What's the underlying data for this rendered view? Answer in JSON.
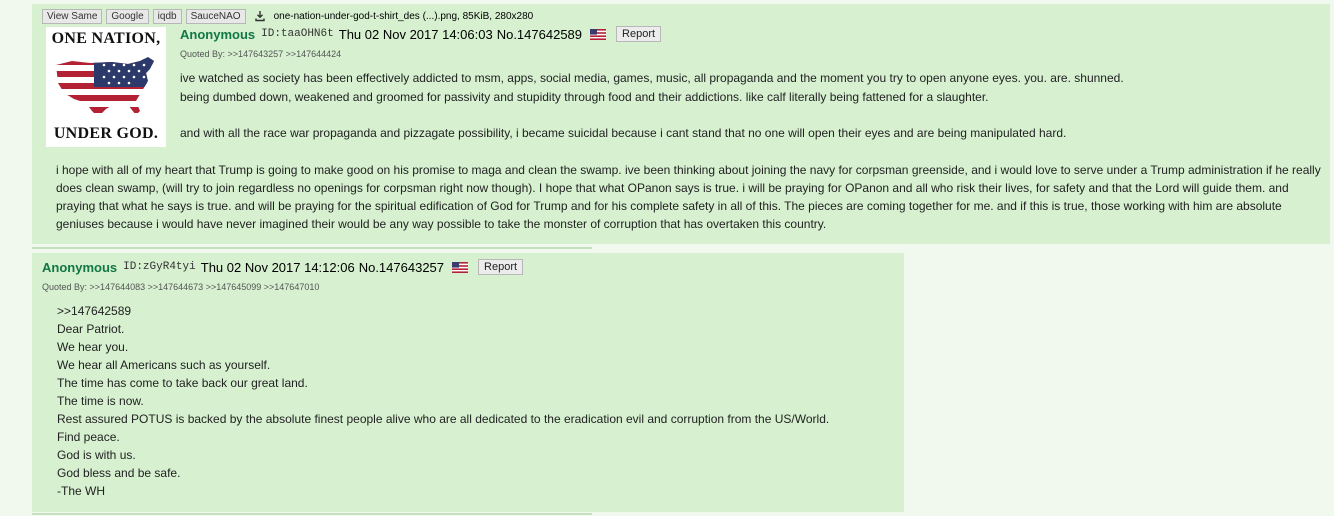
{
  "colors": {
    "page_background": "#f1f8ee",
    "post_background": "#d6f0d0",
    "name": "#117743"
  },
  "post1": {
    "file": {
      "buttons": [
        "View Same",
        "Google",
        "iqdb",
        "SauceNAO"
      ],
      "download_icon": "download-icon",
      "info": "one-nation-under-god-t-shirt_des (...).png, 85KiB, 280x280",
      "thumb_text_top": "ONE NATION,",
      "thumb_text_bottom": "UNDER GOD."
    },
    "name": "Anonymous",
    "poster_id": "ID:taaOHN6t",
    "date": "Thu 02 Nov 2017 14:06:03",
    "post_no": "No.147642589",
    "flag_icon": "us-flag-icon",
    "report": "Report",
    "quoted_by_label": "Quoted By:",
    "quoted_by": [
      ">>147643257",
      ">>147644424"
    ],
    "body_lines": [
      "ive watched as society has been effectively addicted to msm, apps, social media, games, music, all propaganda and the moment you try to open anyone eyes. you. are. shunned.",
      "being dumbed down, weakened and groomed for passivity and stupidity through food and their addictions. like calf literally being fattened for a slaughter.",
      "and with all the race war propaganda and pizzagate possibility, i became suicidal because i cant stand that no one will open their eyes and are being manipulated hard."
    ],
    "body_paragraph": "i hope with all of my heart that Trump is going to make good on his promise to maga and clean the swamp. ive been thinking about joining the navy for corpsman greenside, and i would love to serve under a Trump administration if he really does clean swamp, (will try to join regardless no openings for corpsman right now though). I hope that what OPanon says is true. i will be praying for OPanon and all who risk their lives, for safety and that the Lord will guide them. and praying that what he says is true. and will be praying for the spiritual edification of God for Trump and for his complete safety in all of this. The pieces are coming together for me. and if this is true, those working with him are absolute geniuses because i would have never imagined their would be any way possible to take the monster of corruption that has overtaken this country."
  },
  "post2": {
    "name": "Anonymous",
    "poster_id": "ID:zGyR4tyi",
    "date": "Thu 02 Nov 2017 14:12:06",
    "post_no": "No.147643257",
    "flag_icon": "us-flag-icon",
    "report": "Report",
    "quoted_by_label": "Quoted By:",
    "quoted_by": [
      ">>147644083",
      ">>147644673",
      ">>147645099",
      ">>147647010"
    ],
    "body_lines": [
      ">>147642589",
      "Dear Patriot.",
      "We hear you.",
      "We hear all Americans such as yourself.",
      "The time has come to take back our great land.",
      "The time is now.",
      "Rest assured POTUS is backed by the absolute finest people alive who are all dedicated to the eradication evil and corruption from the US/World.",
      "Find peace.",
      "God is with us.",
      "God bless and be safe.",
      "-The WH"
    ]
  }
}
